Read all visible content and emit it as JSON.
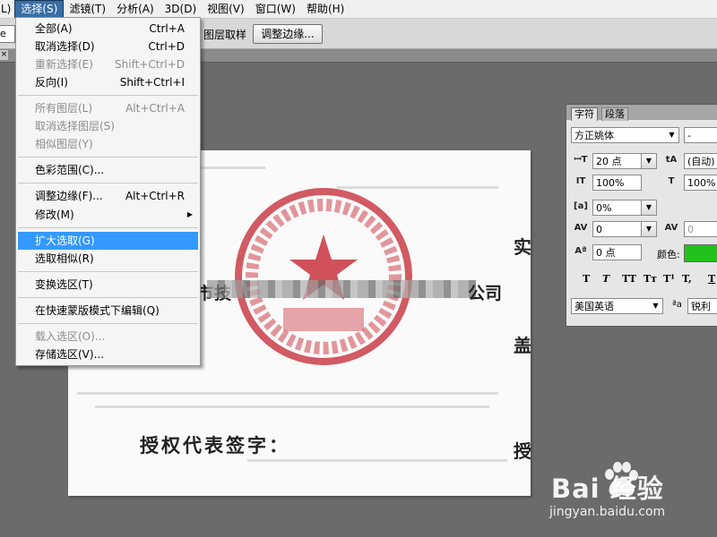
{
  "menubar": {
    "items": [
      "L)",
      "选择(S)",
      "滤镜(T)",
      "分析(A)",
      "3D(D)",
      "视图(V)",
      "窗口(W)",
      "帮助(H)"
    ]
  },
  "options_bar": {
    "left_box": "e",
    "sample_label": "图层取样",
    "refine_edge_button": "调整边缘..."
  },
  "select_menu": {
    "items": [
      {
        "label": "全部(A)",
        "shortcut": "Ctrl+A",
        "enabled": true
      },
      {
        "label": "取消选择(D)",
        "shortcut": "Ctrl+D",
        "enabled": true
      },
      {
        "label": "重新选择(E)",
        "shortcut": "Shift+Ctrl+D",
        "enabled": false
      },
      {
        "label": "反向(I)",
        "shortcut": "Shift+Ctrl+I",
        "enabled": true
      },
      {
        "label": "所有图层(L)",
        "shortcut": "Alt+Ctrl+A",
        "enabled": false
      },
      {
        "label": "取消选择图层(S)",
        "shortcut": "",
        "enabled": false
      },
      {
        "label": "相似图层(Y)",
        "shortcut": "",
        "enabled": false
      },
      {
        "label": "色彩范围(C)...",
        "shortcut": "",
        "enabled": true
      },
      {
        "label": "调整边缘(F)...",
        "shortcut": "Alt+Ctrl+R",
        "enabled": true
      },
      {
        "label": "修改(M)",
        "shortcut": "",
        "enabled": true,
        "submenu": true
      },
      {
        "label": "扩大选取(G)",
        "shortcut": "",
        "enabled": true,
        "highlighted": true
      },
      {
        "label": "选取相似(R)",
        "shortcut": "",
        "enabled": true
      },
      {
        "label": "变换选区(T)",
        "shortcut": "",
        "enabled": true
      },
      {
        "label": "在快速蒙版模式下编辑(Q)",
        "shortcut": "",
        "enabled": true
      },
      {
        "label": "载入选区(O)...",
        "shortcut": "",
        "enabled": false
      },
      {
        "label": "存储选区(V)...",
        "shortcut": "",
        "enabled": true
      }
    ]
  },
  "character_panel": {
    "tabs": [
      "字符",
      "段落"
    ],
    "font_family": "方正姚体",
    "font_style": "-",
    "font_size": "20 点",
    "leading": "(自动)",
    "vertical_scale": "100%",
    "horizontal_scale": "100%",
    "tracking_pct": "0%",
    "kerning": "0",
    "tracking": "0",
    "baseline_shift": "0 点",
    "color_label": "颜色:",
    "color": "#22c21b",
    "format_buttons": [
      "T",
      "T",
      "TT",
      "Tт",
      "T¹",
      "T,",
      "T"
    ],
    "language": "美国英语",
    "aa_icon": "ªa",
    "antialias": "锐利"
  },
  "document": {
    "company_prefix": "市技",
    "company_suffix": "公司",
    "signature_label": "授权代表签字：",
    "right_chars": [
      "实",
      "盖",
      "授"
    ],
    "seal_color": "#c8323c"
  },
  "watermark": {
    "text": "Bai 经验",
    "url": "jingyan.baidu.com"
  }
}
